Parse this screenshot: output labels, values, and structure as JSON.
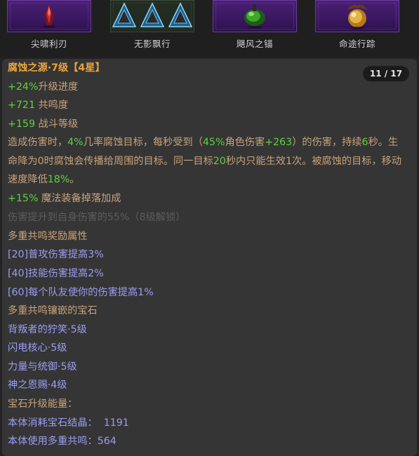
{
  "gems": [
    {
      "label": "尖啸利刃",
      "icon": "red-crystal-icon"
    },
    {
      "label": "无影飘行",
      "icon": "triangle-crystals-icon"
    },
    {
      "label": "飓风之锚",
      "icon": "green-anchor-icon"
    },
    {
      "label": "命途行踪",
      "icon": "golden-orb-icon"
    }
  ],
  "pager": {
    "text": "11 / 17"
  },
  "item": {
    "title": "腐蚀之源·7级【4星】",
    "stat_progress_value": "+24%",
    "stat_progress_label": "升级进度",
    "stat_resonance_value": "+721",
    "stat_resonance_label": " 共鸣度",
    "stat_combat_value": "+159",
    "stat_combat_label": " 战斗等级",
    "desc": {
      "p1": "造成伤害时，",
      "v1": "4%",
      "p2": "几率腐蚀目标，每秒受到（",
      "v2": "45%",
      "p3": "角色伤害",
      "v3": "+263",
      "p4": "）的伤害，持续",
      "v4": "6",
      "p5": "秒。生命降为0时腐蚀会传播给周围的目标。同一目标",
      "v5": "20",
      "p6": "秒内只能生效1次。被腐蚀的目标，移动速度降低",
      "v6": "18%",
      "p7": "。"
    },
    "drop_value": "+15%",
    "drop_label": " 魔法装备掉落加成",
    "locked_text": "伤害提升到自身伤害的55%（8级解锁）",
    "resonance_bonus_header": "多重共鸣奖励属性",
    "bonuses": [
      "[20]普攻伤害提高3%",
      "[40]技能伤害提高2%",
      "[60]每个队友使你的伤害提高1%"
    ],
    "inlaid_header": "多重共鸣镶嵌的宝石",
    "inlaid_gems": [
      "背叛者的狞笑·5级",
      "闪电核心·5级",
      "力量与统御·5级",
      "神之恩赐·4级"
    ],
    "upgrade_energy_header": "宝石升级能量：",
    "energy_crystal": "本体消耗宝石结晶：  1191",
    "energy_resonance": "本体使用多重共鸣：564"
  },
  "colors": {
    "title": "#e8a33d",
    "positive": "#5fd13f",
    "text": "#c8a27a",
    "muted": "#5c5c5c",
    "bonus": "#9c9cf2"
  }
}
